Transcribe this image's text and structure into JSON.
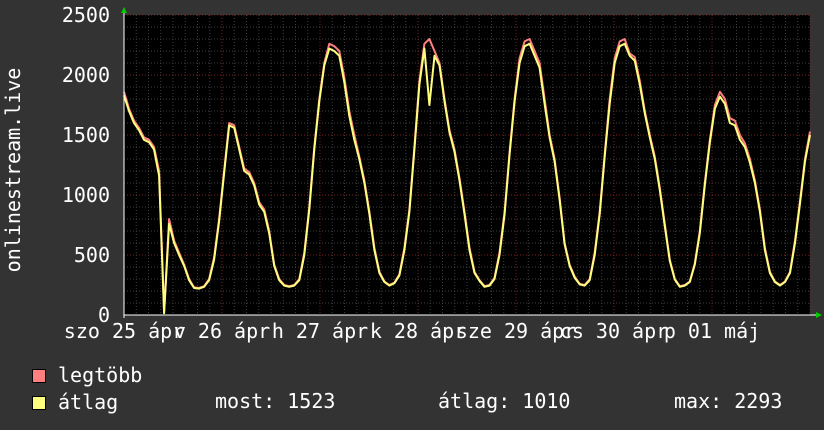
{
  "chart_data": {
    "type": "line",
    "ylabel": "onlinestream.live",
    "ylim": [
      0,
      2500
    ],
    "yticks": [
      0,
      500,
      1000,
      1500,
      2000,
      2500
    ],
    "grid": true,
    "xticks": [
      "szo 25 ápr",
      "v 26 ápr",
      "h 27 ápr",
      "k 28 ápr",
      "sze 29 ápr",
      "cs 30 ápr",
      "p 01 máj"
    ],
    "series": [
      {
        "name": "legtöbb",
        "color": "#ff7f7f",
        "values": [
          1860,
          1720,
          1620,
          1560,
          1480,
          1460,
          1400,
          1200,
          20,
          800,
          620,
          520,
          420,
          300,
          230,
          225,
          240,
          300,
          480,
          800,
          1200,
          1600,
          1580,
          1400,
          1220,
          1190,
          1100,
          940,
          880,
          700,
          420,
          300,
          250,
          240,
          250,
          300,
          520,
          900,
          1400,
          1800,
          2100,
          2260,
          2240,
          2200,
          1980,
          1700,
          1500,
          1320,
          1120,
          860,
          560,
          360,
          280,
          250,
          270,
          340,
          560,
          880,
          1400,
          1950,
          2260,
          2300,
          2200,
          2100,
          1800,
          1540,
          1380,
          1140,
          860,
          560,
          360,
          290,
          240,
          250,
          310,
          520,
          860,
          1360,
          1800,
          2140,
          2280,
          2300,
          2200,
          2100,
          1800,
          1500,
          1300,
          980,
          600,
          420,
          320,
          260,
          250,
          300,
          520,
          860,
          1340,
          1800,
          2140,
          2280,
          2300,
          2180,
          2150,
          1950,
          1700,
          1500,
          1320,
          1060,
          760,
          460,
          300,
          240,
          250,
          280,
          430,
          700,
          1100,
          1460,
          1750,
          1860,
          1800,
          1640,
          1620,
          1500,
          1430,
          1300,
          1120,
          880,
          560,
          360,
          280,
          250,
          280,
          360,
          620,
          950,
          1300,
          1530
        ]
      },
      {
        "name": "átlag",
        "color": "#ffff7f",
        "values": [
          1830,
          1700,
          1600,
          1540,
          1460,
          1440,
          1380,
          1160,
          15,
          760,
          600,
          500,
          410,
          290,
          225,
          220,
          235,
          290,
          460,
          780,
          1180,
          1580,
          1560,
          1380,
          1200,
          1170,
          1080,
          920,
          860,
          680,
          410,
          290,
          245,
          235,
          245,
          290,
          500,
          880,
          1380,
          1780,
          2080,
          2220,
          2200,
          2160,
          1940,
          1660,
          1460,
          1300,
          1100,
          840,
          540,
          350,
          275,
          245,
          265,
          330,
          540,
          860,
          1380,
          1920,
          2220,
          1750,
          2160,
          2080,
          1780,
          1520,
          1360,
          1120,
          840,
          540,
          350,
          285,
          235,
          245,
          300,
          500,
          840,
          1340,
          1780,
          2100,
          2240,
          2260,
          2160,
          2060,
          1760,
          1480,
          1280,
          960,
          590,
          410,
          310,
          255,
          245,
          290,
          500,
          840,
          1320,
          1760,
          2100,
          2240,
          2260,
          2160,
          2120,
          1920,
          1680,
          1480,
          1300,
          1040,
          740,
          450,
          295,
          235,
          245,
          275,
          420,
          680,
          1080,
          1440,
          1720,
          1820,
          1760,
          1600,
          1580,
          1460,
          1400,
          1270,
          1100,
          860,
          540,
          350,
          275,
          245,
          275,
          350,
          600,
          930,
          1280,
          1500
        ]
      }
    ]
  },
  "legend": [
    {
      "label": "legtöbb",
      "color": "#ff7f7f"
    },
    {
      "label": "átlag",
      "color": "#ffff7f"
    }
  ],
  "stats": {
    "now": "most: 1523",
    "avg": "átlag: 1010",
    "max": "max: 2293"
  }
}
